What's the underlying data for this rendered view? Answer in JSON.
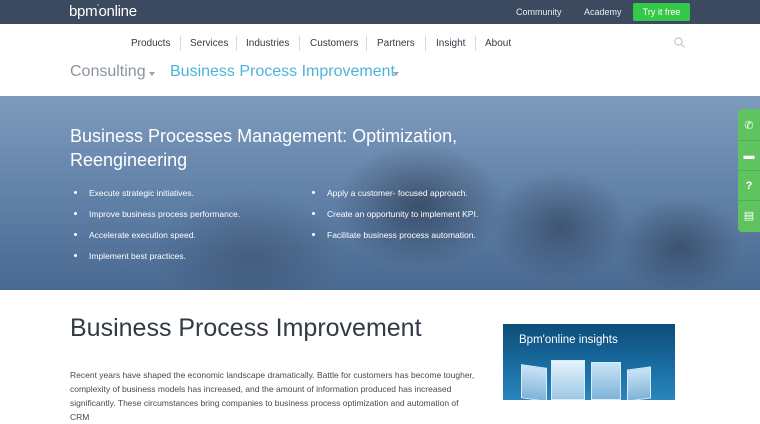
{
  "topbar": {
    "logo_prefix": "bpm",
    "logo_mark": "'",
    "logo_suffix": "online",
    "links": [
      "Community",
      "Academy"
    ],
    "try_label": "Try it free",
    "try_color": "#35c94a"
  },
  "nav": {
    "items": [
      "Products",
      "Services",
      "Industries",
      "Customers",
      "Partners",
      "Insight",
      "About"
    ],
    "search_icon": "search-icon"
  },
  "breadcrumbs": {
    "first": "Consulting",
    "second": "Business Process Improvement",
    "first_color": "#8c949d",
    "second_color": "#4fb3d9"
  },
  "hero": {
    "title": "Business Processes Management: Optimization, Reengineering",
    "bullets_left": [
      "Execute strategic initiatives.",
      "Improve business process performance.",
      "Accelerate execution speed.",
      "Implement best practices."
    ],
    "bullets_right": [
      "Apply a customer- focused approach.",
      "Create an opportunity to implement KPI.",
      "Facilitate business process automation."
    ]
  },
  "side_tools": {
    "icons": [
      "phone-icon",
      "chat-icon",
      "help-icon",
      "feedback-icon"
    ],
    "glyphs": [
      "✆",
      "▬",
      "?",
      "▤"
    ],
    "color": "#5fc45f"
  },
  "main": {
    "title": "Business Process Improvement",
    "text": "Recent years have shaped the economic landscape dramatically. Battle for customers has become tougher, complexity of business models has increased, and the amount of information produced has increased significantly. These circumstances bring companies to business process optimization and automation of CRM"
  },
  "insights": {
    "label": "Bpm'online insights"
  }
}
